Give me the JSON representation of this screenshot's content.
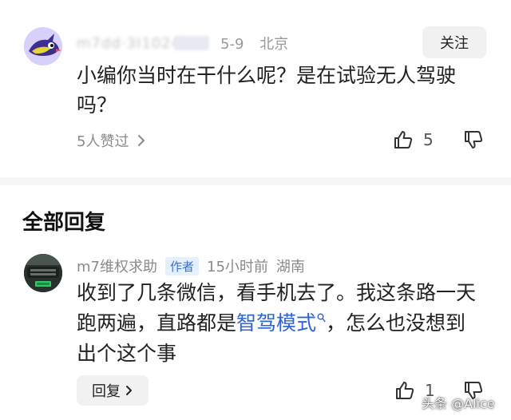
{
  "colors": {
    "background": "#ffffff",
    "divider": "#f6f6f6",
    "muted_text": "#9a9a9a",
    "link": "#2e64d8",
    "author_tag_bg": "#e6f0fd",
    "author_tag_text": "#3a6fcf",
    "button_bg": "#f1f1f1"
  },
  "top_comment": {
    "username": "m7dd·3I1024",
    "date": "5-9",
    "location": "北京",
    "follow_label": "关注",
    "text": "小编你当时在干什么呢？是在试验无人驾驶吗？",
    "likers_label": "5人赞过",
    "likers_icon": "chevron-right-icon",
    "like_icon": "thumbs-up-icon",
    "like_count": "5",
    "dislike_icon": "thumbs-down-icon"
  },
  "replies_section": {
    "title": "全部回复"
  },
  "reply": {
    "username": "m7维权求助",
    "author_tag": "作者",
    "time": "15小时前",
    "location": "湖南",
    "text_before": "收到了几条微信，看手机去了。我这条路一天跑两遍，直路都是",
    "link_text": "智驾模式",
    "link_icon": "search-icon",
    "text_after": "，怎么也没想到出个这个事",
    "reply_button_label": "回复",
    "reply_button_icon": "chevron-right-icon",
    "like_icon": "thumbs-up-icon",
    "like_count": "1",
    "dislike_icon": "thumbs-down-icon"
  },
  "watermark": "头条 @Alice"
}
